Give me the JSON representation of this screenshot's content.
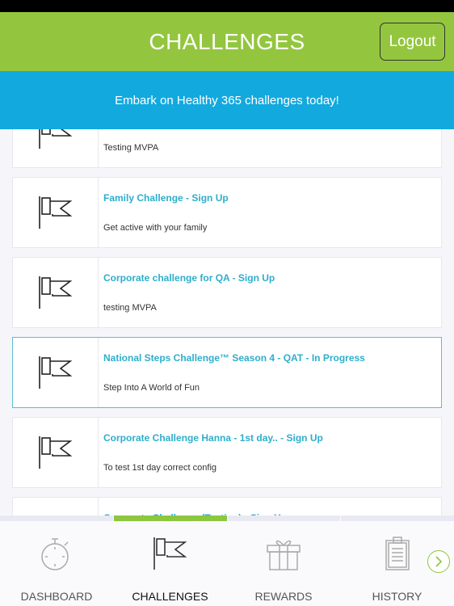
{
  "header": {
    "title": "CHALLENGES",
    "logout_label": "Logout"
  },
  "banner": {
    "text": "Embark on Healthy 365 challenges today!"
  },
  "challenges": [
    {
      "title": "",
      "description": "Testing MVPA"
    },
    {
      "title": "Family Challenge - Sign Up",
      "description": "Get active with your family"
    },
    {
      "title": "Corporate challenge for QA - Sign Up",
      "description": "testing MVPA"
    },
    {
      "title": "National Steps Challenge™ Season 4 - QAT - In Progress",
      "description": "Step Into A World of Fun",
      "active": true
    },
    {
      "title": "Corporate Challenge Hanna - 1st day.. - Sign Up",
      "description": "To test 1st day correct config"
    },
    {
      "title": "Corporate Challenge (Testing) - Sign Up",
      "description": ""
    }
  ],
  "tabs": [
    {
      "label": "DASHBOARD",
      "icon": "stopwatch-icon"
    },
    {
      "label": "CHALLENGES",
      "icon": "flag-icon",
      "selected": true
    },
    {
      "label": "REWARDS",
      "icon": "gift-icon"
    },
    {
      "label": "HISTORY",
      "icon": "clipboard-icon"
    }
  ],
  "colors": {
    "header": "#93c63e",
    "banner": "#12a9df",
    "title": "#2eaecb",
    "selected_tab": "#8dc63f"
  }
}
